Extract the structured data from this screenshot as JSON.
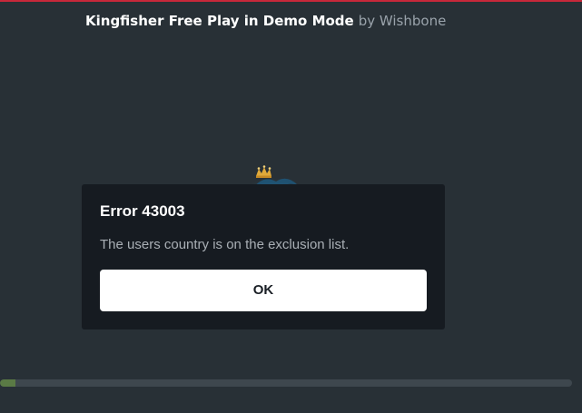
{
  "header": {
    "game_title": "Kingfisher Free Play in Demo Mode",
    "by_text": "by Wishbone"
  },
  "logo": {
    "icon": "kingfisher-crown-logo-icon"
  },
  "dialog": {
    "title": "Error 43003",
    "message": "The users country is on the exclusion list.",
    "ok_label": "OK"
  },
  "loading": {
    "progress": 0.027
  },
  "colors": {
    "background": "#283036",
    "dialog_background": "#161b21",
    "accent_top": "#c8283a",
    "progress_fill": "#5a7a45",
    "progress_track": "#3e474e"
  }
}
